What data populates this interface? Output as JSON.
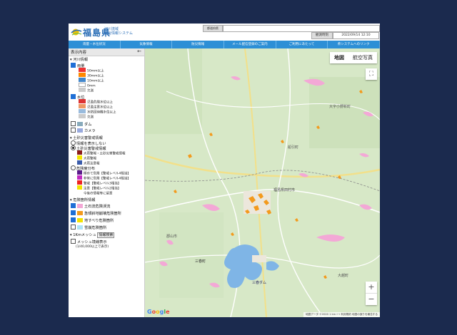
{
  "header": {
    "title": "福島県",
    "subtitle_line1": "河川流域",
    "subtitle_line2": "総合情報システム",
    "search_label": "都道府県",
    "update_label": "観測時刻",
    "update_time": "2022/09/14 12:10"
  },
  "nav": [
    "雨量・水位状況",
    "気象情報",
    "防災情報",
    "メール配信登録のご案内",
    "ご利用にあたって",
    "県システムへのリンク"
  ],
  "sidebar": {
    "title": "表示内容",
    "close_icon": "arrow-left-icon",
    "river_section": "▾ 河川情報",
    "rain_label": "雨量",
    "rain_legend": [
      "50mm以上",
      "30mm以上",
      "10mm以上",
      "0mm",
      "欠測"
    ],
    "water_label": "水位",
    "water_legend": [
      "氾濫危険水位以上",
      "氾濫注意水位以上",
      "水防団待機水位以上",
      "欠測"
    ],
    "dam_label": "ダム",
    "camera_label": "カメラ",
    "sediment_section": "▾ 土砂災害警戒情報",
    "sed_none": "情報を表示しない",
    "sed_warn_label": "土砂災害警戒情報",
    "sed_warn_legend": [
      "大雨警報・土砂災害警戒情報",
      "大雨警報",
      "大雨注意報"
    ],
    "sed_level_label": "危険度分布",
    "sed_level_legend": [
      "極めて危険【警戒レベル4相当】",
      "非常に危険【警戒レベル4相当】",
      "警戒【警戒レベル3相当】",
      "注意【警戒レベル2相当】",
      "今後の情報等に留意"
    ],
    "hazard_section": "▾ 危険箇所情報",
    "hazard_items": [
      "土石流危険渓流",
      "急傾斜地崩壊危険箇所",
      "地すべり危険箇所",
      "雪崩危険箇所"
    ],
    "mesh_section": "▾ 1Kmメッシュ",
    "mesh_button": "情報検索",
    "mesh_check": "メッシュ境線表示",
    "mesh_note": "(1/40,000以上で表示)"
  },
  "map": {
    "type_map": "地図",
    "type_satellite": "航空写真",
    "fullscreen_icon": "fullscreen-icon",
    "zoom_in": "+",
    "zoom_out": "−",
    "attribution": "地図データ ©2020   1 km ⟷   利用規約   地図の誤りを報告する",
    "place_labels": [
      "大字小野新町",
      "福島県田村市",
      "三春ダム",
      "三春町",
      "郡山市",
      "船引町",
      "大越町"
    ]
  },
  "colors": {
    "accent": "#2d8fd6",
    "brand": "#2c6fb7",
    "background": "#1b2a4e"
  }
}
